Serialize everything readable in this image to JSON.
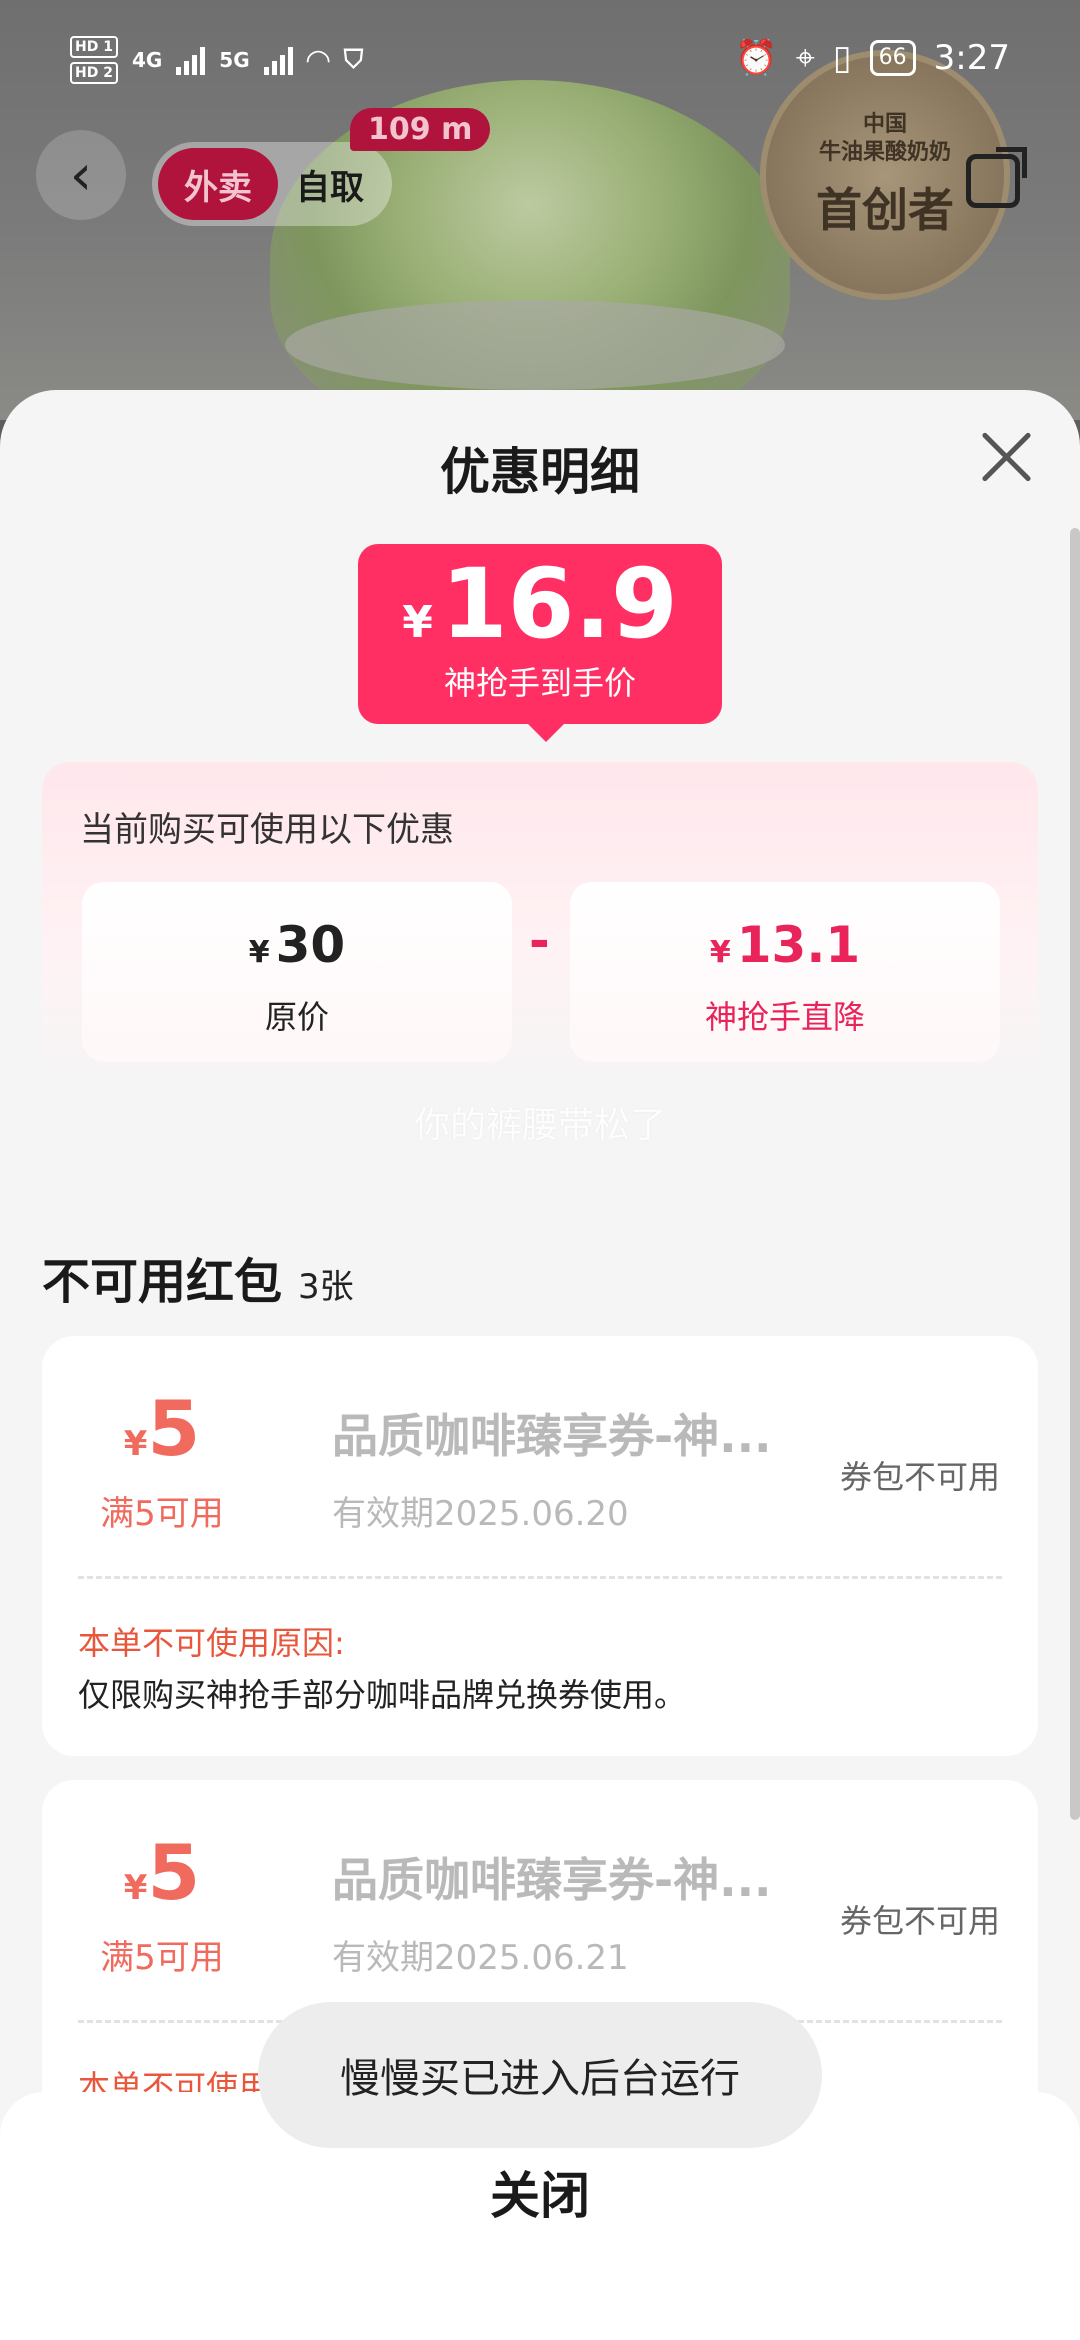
{
  "status_bar": {
    "left": [
      "HD 1",
      "HD 2",
      "4G",
      "5G"
    ],
    "time": "3:27",
    "battery": "66"
  },
  "header": {
    "mode_active": "外卖",
    "mode_inactive": "自取",
    "distance": "109 m",
    "seal_line1": "中国",
    "seal_line2": "牛油果酸奶奶",
    "seal_line3": "首创者"
  },
  "sheet": {
    "title": "优惠明细",
    "price": {
      "currency": "¥",
      "amount": "16.9",
      "label": "神抢手到手价"
    },
    "discounts": {
      "title": "当前购买可使用以下优惠",
      "original": {
        "currency": "¥",
        "amount": "30",
        "label": "原价"
      },
      "operator": "-",
      "reduction": {
        "currency": "¥",
        "amount": "13.1",
        "label": "神抢手直降"
      }
    },
    "watermark": "你的裤腰带松了",
    "unavailable": {
      "title": "不可用红包",
      "count": "3张",
      "coupons": [
        {
          "currency": "¥",
          "amount": "5",
          "condition": "满5可用",
          "name": "品质咖啡臻享券-神...",
          "validity": "有效期2025.06.20",
          "status": "券包不可用",
          "reason_title": "本单不可使用原因:",
          "reason": "仅限购买神抢手部分咖啡品牌兑换券使用。"
        },
        {
          "currency": "¥",
          "amount": "5",
          "condition": "满5可用",
          "name": "品质咖啡臻享券-神...",
          "validity": "有效期2025.06.21",
          "status": "券包不可用",
          "reason_title": "本单不可使用原因:",
          "reason": ""
        }
      ]
    },
    "close_label": "关闭"
  },
  "toast": "慢慢买已进入后台运行",
  "colors": {
    "accent": "#ff2e63",
    "coupon_orange": "#f06a5e",
    "reason_red": "#e8573b"
  }
}
